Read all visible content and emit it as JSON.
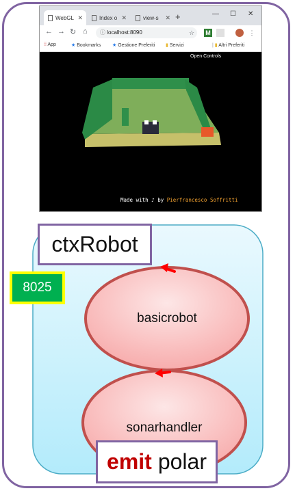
{
  "browser": {
    "tabs": [
      {
        "label": "WebGL"
      },
      {
        "label": "Index o"
      },
      {
        "label": "view-s"
      }
    ],
    "url": "localhost:8090",
    "bookmarks": [
      "App",
      "Bookmarks",
      "Gestione Preferiti",
      "Servizi",
      "Altri Preferiti"
    ],
    "scene": {
      "open_controls": "Open Controls",
      "credit_prefix": "Made with",
      "credit_by": "by",
      "credit_author": "Pierfrancesco Soffritti"
    }
  },
  "diagram": {
    "context_label": "ctxRobot",
    "port": "8025",
    "actors": [
      "basicrobot",
      "sonarhandler"
    ],
    "emit_keyword": "emit",
    "emit_event": "polar",
    "colors": {
      "frame": "#8064a2",
      "context_fill": "#bdeefa",
      "actor_fill": "#f8b8b8",
      "actor_stroke": "#c0504d",
      "arrow": "#ff0000",
      "port_fill": "#00b050",
      "port_border": "#ffff00",
      "keyword": "#c00000"
    }
  }
}
